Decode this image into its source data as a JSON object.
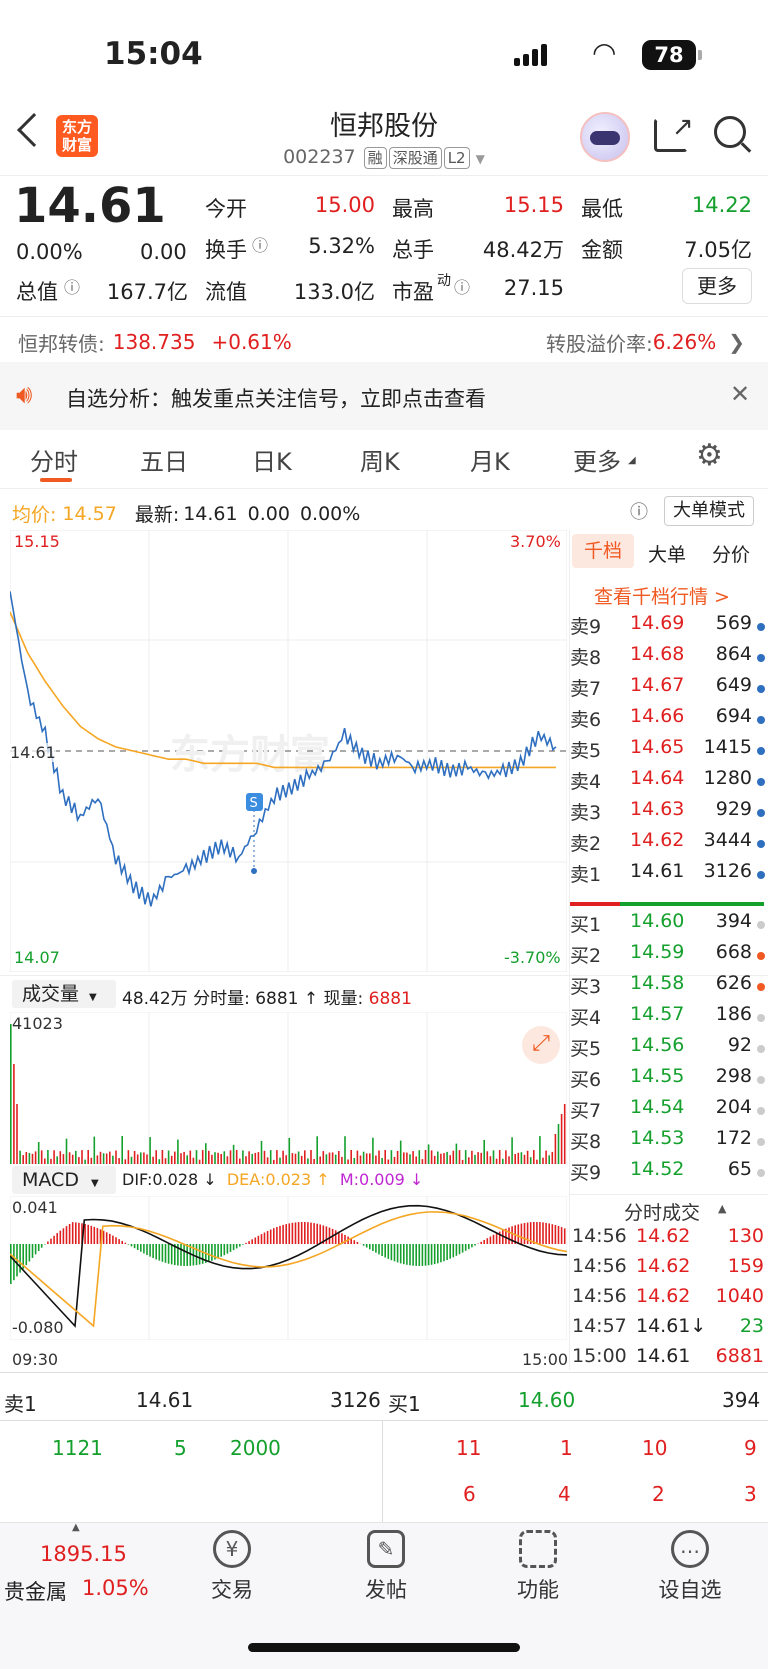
{
  "status": {
    "time": "15:04",
    "battery": "78"
  },
  "header": {
    "logo_line1": "东方",
    "logo_line2": "财富",
    "name": "恒邦股份",
    "code": "002237",
    "tags": [
      "融",
      "深股通",
      "L2"
    ]
  },
  "quote": {
    "price": "14.61",
    "change_pct": "0.00%",
    "change": "0.00",
    "open_label": "今开",
    "open": "15.00",
    "high_label": "最高",
    "high": "15.15",
    "low_label": "最低",
    "low": "14.22",
    "turnover_label": "换手",
    "turnover": "5.32%",
    "volume_label": "总手",
    "volume": "48.42万",
    "amount_label": "金额",
    "amount": "7.05亿",
    "mktcap_label": "总值",
    "mktcap": "167.7亿",
    "float_label": "流值",
    "float": "133.0亿",
    "pe_label": "市盈",
    "pe_sup": "动",
    "pe": "27.15",
    "more": "更多"
  },
  "bond": {
    "name": "恒邦转债:",
    "price": "138.735",
    "change": "+0.61%",
    "premium_label": "转股溢价率:",
    "premium": "6.26%"
  },
  "notice": {
    "text": "自选分析：触发重点关注信号，立即点击查看"
  },
  "tabs": [
    "分时",
    "五日",
    "日K",
    "周K",
    "月K",
    "更多"
  ],
  "chart_header": {
    "avg_label": "均价:",
    "avg": "14.57",
    "latest_label": "最新:",
    "latest": "14.61",
    "chg": "0.00",
    "pct": "0.00%",
    "big_order_mode": "大单模式"
  },
  "axis": {
    "top_price": "15.15",
    "bottom_price": "14.07",
    "top_pct": "3.70%",
    "bottom_pct": "-3.70%",
    "ref_price": "14.61",
    "vol_max": "41023",
    "macd_top": "0.041",
    "macd_bottom": "-0.080",
    "time_start": "09:30",
    "time_end": "15:00"
  },
  "volume_bar": {
    "label": "成交量",
    "total": "48.42万",
    "minute_label": "分时量: 6881 ↑ 现量:",
    "now": "6881"
  },
  "macd_bar": {
    "label": "MACD",
    "dif": "DIF:0.028 ↓",
    "dea": "DEA:0.023 ↑",
    "m": "M:0.009 ↓"
  },
  "order_book": {
    "tabs": [
      "千档",
      "大单",
      "分价"
    ],
    "link": "查看千档行情 >",
    "asks": [
      {
        "label": "卖9",
        "price": "14.69",
        "vol": "569"
      },
      {
        "label": "卖8",
        "price": "14.68",
        "vol": "864"
      },
      {
        "label": "卖7",
        "price": "14.67",
        "vol": "649"
      },
      {
        "label": "卖6",
        "price": "14.66",
        "vol": "694"
      },
      {
        "label": "卖5",
        "price": "14.65",
        "vol": "1415"
      },
      {
        "label": "卖4",
        "price": "14.64",
        "vol": "1280"
      },
      {
        "label": "卖3",
        "price": "14.63",
        "vol": "929"
      },
      {
        "label": "卖2",
        "price": "14.62",
        "vol": "3444"
      },
      {
        "label": "卖1",
        "price": "14.61",
        "vol": "3126"
      }
    ],
    "bids": [
      {
        "label": "买1",
        "price": "14.60",
        "vol": "394"
      },
      {
        "label": "买2",
        "price": "14.59",
        "vol": "668"
      },
      {
        "label": "买3",
        "price": "14.58",
        "vol": "626"
      },
      {
        "label": "买4",
        "price": "14.57",
        "vol": "186"
      },
      {
        "label": "买5",
        "price": "14.56",
        "vol": "92"
      },
      {
        "label": "买6",
        "price": "14.55",
        "vol": "298"
      },
      {
        "label": "买7",
        "price": "14.54",
        "vol": "204"
      },
      {
        "label": "买8",
        "price": "14.53",
        "vol": "172"
      },
      {
        "label": "买9",
        "price": "14.52",
        "vol": "65"
      }
    ]
  },
  "trades": {
    "title": "分时成交",
    "rows": [
      {
        "time": "14:56",
        "price": "14.62",
        "vol": "130"
      },
      {
        "time": "14:56",
        "price": "14.62",
        "vol": "159"
      },
      {
        "time": "14:56",
        "price": "14.62",
        "vol": "1040"
      },
      {
        "time": "14:57",
        "price": "14.61↓",
        "vol": "23"
      },
      {
        "time": "15:00",
        "price": "14.61",
        "vol": "6881"
      }
    ]
  },
  "queue": {
    "sell_label": "卖1",
    "sell_price": "14.61",
    "sell_vol": "3126",
    "buy_label": "买1",
    "buy_price": "14.60",
    "buy_vol": "394",
    "sell_orders": [
      "1121",
      "5",
      "2000"
    ],
    "buy_orders_row1": [
      "11",
      "1",
      "10",
      "9"
    ],
    "buy_orders_row2": [
      "6",
      "4",
      "2",
      "3"
    ]
  },
  "bottom": {
    "index_value": "1895.15",
    "index_name": "贵金属",
    "index_pct": "1.05%",
    "nav": [
      "交易",
      "发帖",
      "功能",
      "设自选"
    ]
  },
  "chart_data": {
    "type": "line",
    "title": "",
    "x": [
      "09:30",
      "15:00"
    ],
    "ylim": [
      14.07,
      15.15
    ],
    "series": [
      {
        "values": [
          15.0,
          14.75,
          14.65,
          14.5,
          14.45,
          14.5,
          14.35,
          14.28,
          14.24,
          14.3,
          14.32,
          14.35,
          14.38,
          14.35,
          14.42,
          14.5,
          14.52,
          14.55,
          14.58,
          14.65,
          14.6,
          14.58,
          14.6,
          14.57,
          14.58,
          14.56,
          14.57,
          14.55,
          14.56,
          14.58,
          14.65,
          14.62
        ]
      },
      {
        "values": [
          14.95,
          14.85,
          14.78,
          14.72,
          14.67,
          14.64,
          14.62,
          14.61,
          14.6,
          14.59,
          14.59,
          14.58,
          14.58,
          14.58,
          14.58,
          14.57,
          14.57,
          14.57,
          14.57,
          14.57,
          14.57,
          14.57,
          14.57,
          14.57,
          14.57,
          14.57,
          14.57,
          14.57,
          14.57,
          14.57,
          14.57,
          14.57
        ]
      }
    ]
  }
}
